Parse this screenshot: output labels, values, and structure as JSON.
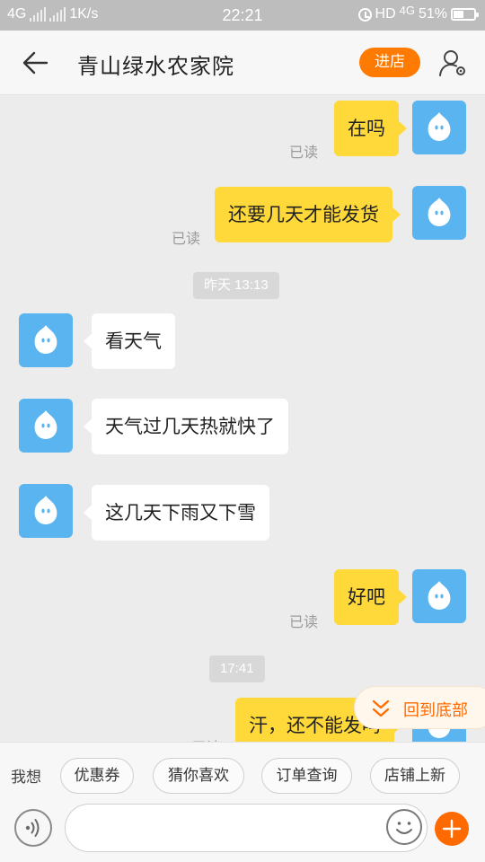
{
  "status_bar": {
    "network": "4G",
    "speed": "1K/s",
    "time": "22:21",
    "hd": "HD",
    "network2": "4G",
    "battery": "51%",
    "battery_level": 0.51
  },
  "header": {
    "title": "青山绿水农家院",
    "store_button": "进店"
  },
  "messages": [
    {
      "from": "me",
      "text": "在吗",
      "read": "已读"
    },
    {
      "from": "me",
      "text": "还要几天才能发货",
      "read": "已读"
    },
    {
      "time": "昨天 13:13"
    },
    {
      "from": "other",
      "text": "看天气"
    },
    {
      "from": "other",
      "text": "天气过几天热就快了"
    },
    {
      "from": "other",
      "text": "这几天下雨又下雪"
    },
    {
      "from": "me",
      "text": "好吧",
      "read": "已读"
    },
    {
      "time": "17:41"
    },
    {
      "from": "me",
      "text": "汗，还不能发吗",
      "read": "已读"
    }
  ],
  "back_to_bottom": "回到底部",
  "bottom": {
    "want_label": "我想",
    "chips": [
      "优惠券",
      "猜你喜欢",
      "订单查询",
      "店铺上新"
    ],
    "input_placeholder": ""
  },
  "colors": {
    "accent": "#ff6a00",
    "my_bubble": "#ffd93a",
    "avatar": "#5ab4ef"
  }
}
